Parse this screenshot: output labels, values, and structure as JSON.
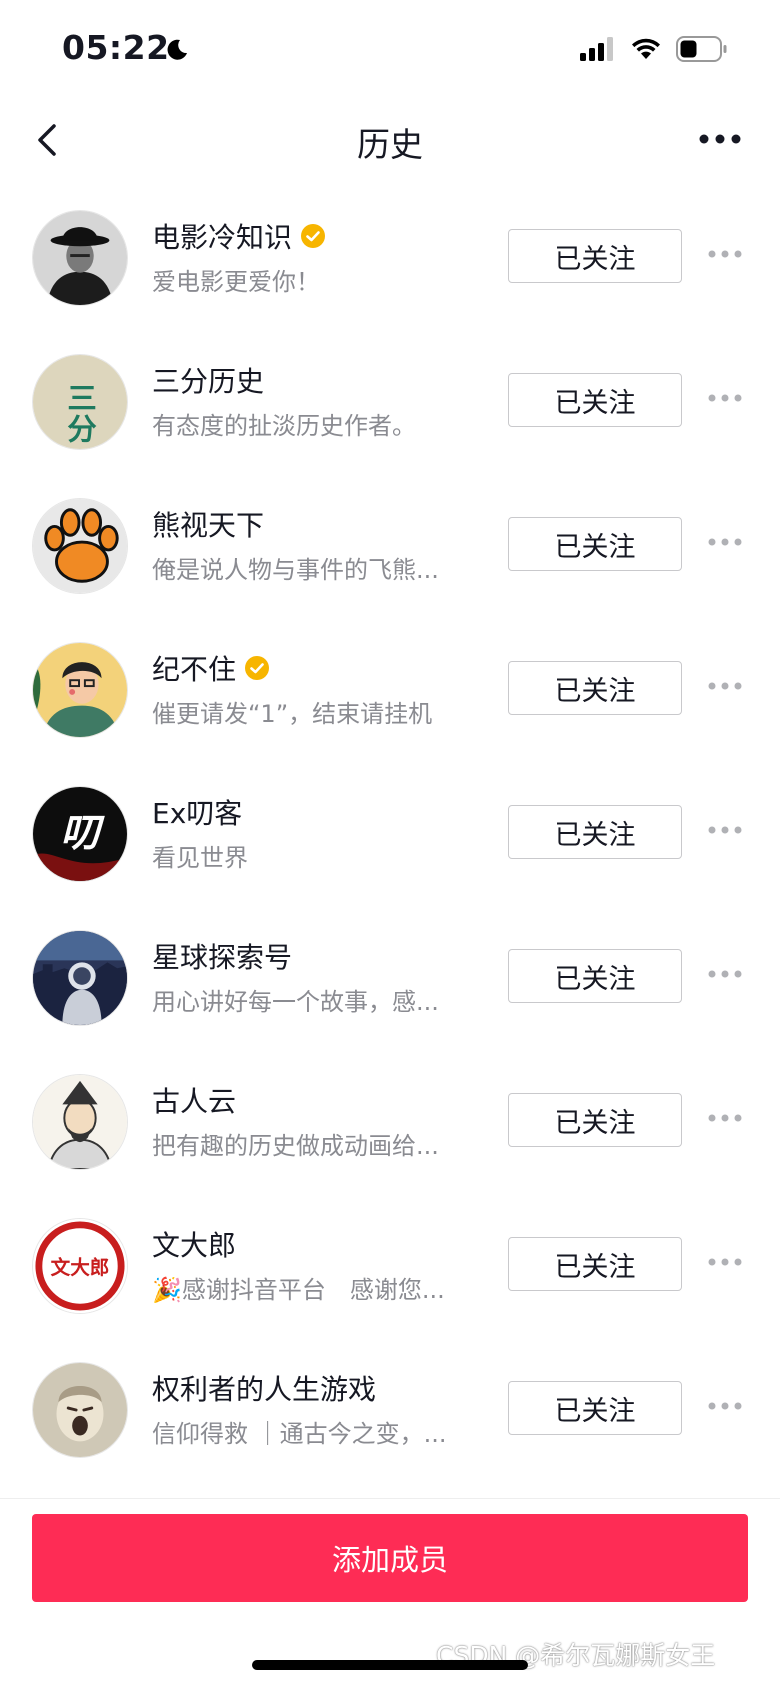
{
  "status_bar": {
    "time": "05:22"
  },
  "nav": {
    "title": "历史"
  },
  "rows": [
    {
      "name": "电影冷知识",
      "desc": "爱电影更爱你！",
      "verified": true,
      "button": "已关注"
    },
    {
      "name": "三分历史",
      "desc": "有态度的扯淡历史作者。",
      "verified": false,
      "button": "已关注",
      "avatar_text": "三分"
    },
    {
      "name": "熊视天下",
      "desc": "俺是说人物与事件的飞熊...",
      "verified": false,
      "button": "已关注"
    },
    {
      "name": "纪不住",
      "desc": "催更请发“1”，结束请挂机",
      "verified": true,
      "button": "已关注"
    },
    {
      "name": "Ex叨客",
      "desc": "看见世界",
      "verified": false,
      "button": "已关注",
      "avatar_text": "叨"
    },
    {
      "name": "星球探索号",
      "desc": "用心讲好每一个故事，感...",
      "verified": false,
      "button": "已关注"
    },
    {
      "name": "古人云",
      "desc": "把有趣的历史做成动画给...",
      "verified": false,
      "button": "已关注"
    },
    {
      "name": "文大郎",
      "desc": "🎉感谢抖音平台　感谢您...",
      "verified": false,
      "button": "已关注",
      "avatar_text": "文大郎"
    },
    {
      "name": "权利者的人生游戏",
      "desc": "信仰得救 ｜通古今之变，...",
      "verified": false,
      "button": "已关注"
    }
  ],
  "footer": {
    "add_button": "添加成员"
  },
  "watermark": "CSDN @希尔瓦娜斯女王",
  "colors": {
    "accent": "#fe2c55",
    "verified": "#f7b500"
  }
}
